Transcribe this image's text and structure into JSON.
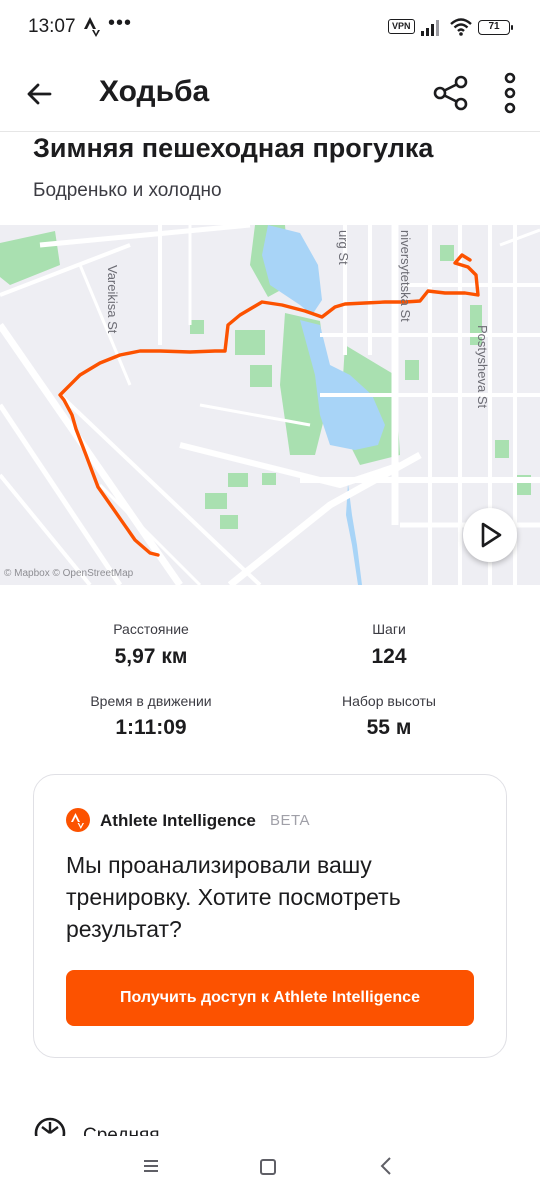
{
  "status_bar": {
    "time": "13:07",
    "dots": "•••",
    "vpn": "VPN",
    "battery": "71",
    "icons": [
      "strava-notification-icon",
      "vpn-icon",
      "signal-icon",
      "wifi-icon",
      "battery-icon"
    ]
  },
  "app_bar": {
    "title": "Ходьба",
    "icons": [
      "arrow-left-icon",
      "share-icon",
      "more-vertical-icon"
    ]
  },
  "activity": {
    "title": "Зимняя пешеходная прогулка",
    "description": "Бодренько и холодно"
  },
  "map": {
    "street_labels": {
      "vareikisa": "Vareikisa St",
      "burg": "urg St",
      "universytetska": "niversytetska St",
      "postysheva": "Postysheva St"
    },
    "attribution": "© Mapbox © OpenStreetMap",
    "route_color": "#fc5200",
    "water_color": "#aad3f5",
    "park_color": "#9fdca9",
    "icons": [
      "play-icon"
    ]
  },
  "stats": [
    {
      "label": "Расстояние",
      "value": "5,97 км"
    },
    {
      "label": "Шаги",
      "value": "124"
    },
    {
      "label": "Время в движении",
      "value": "1:11:09"
    },
    {
      "label": "Набор высоты",
      "value": "55 м"
    }
  ],
  "ai_card": {
    "name": "Athlete Intelligence",
    "badge": "BETA",
    "message": "Мы проанализировали вашу тренировку. Хотите посмотреть результат?",
    "cta": "Получить доступ к Athlete Intelligence",
    "accent": "#fc5200"
  },
  "next_section": {
    "label": "Средняя"
  },
  "nav_bar": {
    "icons": [
      "menu-icon",
      "home-icon",
      "back-icon"
    ]
  }
}
